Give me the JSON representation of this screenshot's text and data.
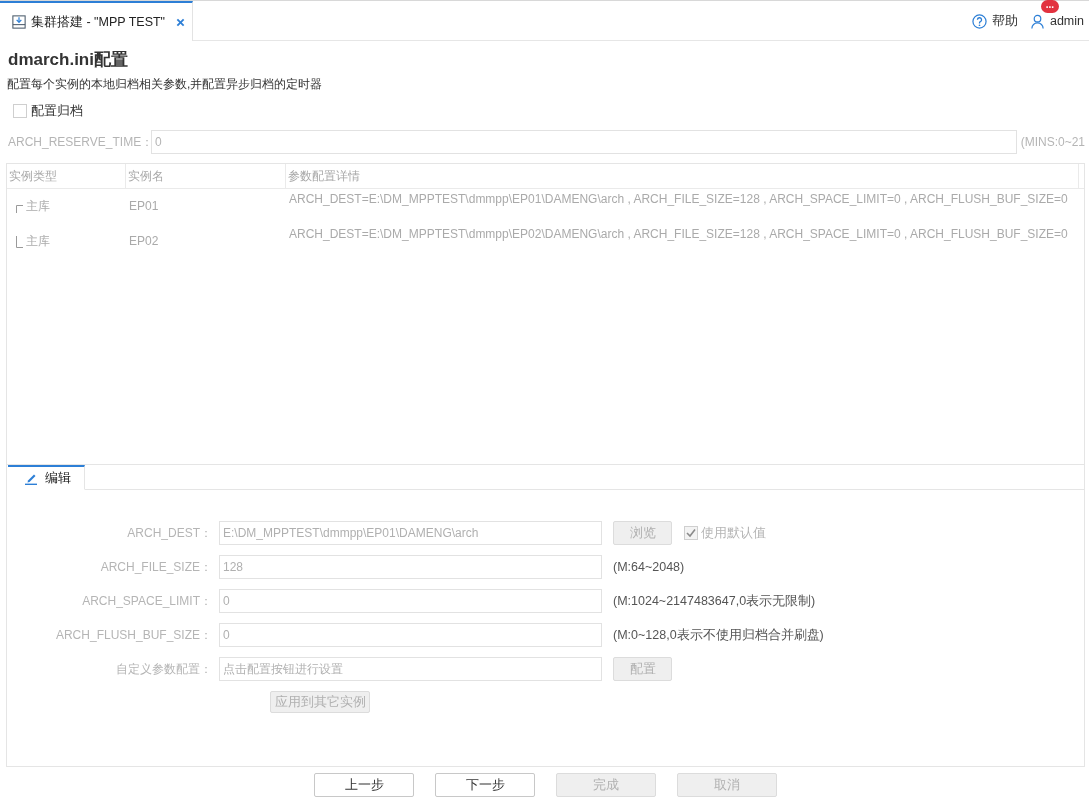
{
  "tabs": [
    {
      "label": "集群搭建 - \"MPP TEST\"",
      "selected": true,
      "closable": true
    }
  ],
  "header": {
    "help": "帮助",
    "user": "admin",
    "badge": "..."
  },
  "page": {
    "title": "dmarch.ini配置",
    "description": "配置每个实例的本地归档相关参数,并配置异步归档的定时器"
  },
  "archive_option": {
    "label": "配置归档",
    "checked": false
  },
  "reserve_time": {
    "label": "ARCH_RESERVE_TIME：",
    "value": "0",
    "hint": "(MINS:0~21",
    "disabled": true
  },
  "table": {
    "columns": [
      "实例类型",
      "实例名",
      "参数配置详情"
    ],
    "rows": [
      {
        "type": "主库",
        "name": "EP01",
        "details": "ARCH_DEST=E:\\DM_MPPTEST\\dmmpp\\EP01\\DAMENG\\arch , ARCH_FILE_SIZE=128 , ARCH_SPACE_LIMIT=0 , ARCH_FLUSH_BUF_SIZE=0"
      },
      {
        "type": "主库",
        "name": "EP02",
        "details": "ARCH_DEST=E:\\DM_MPPTEST\\dmmpp\\EP02\\DAMENG\\arch , ARCH_FILE_SIZE=128 , ARCH_SPACE_LIMIT=0 , ARCH_FLUSH_BUF_SIZE=0"
      }
    ]
  },
  "edit_tabs": [
    {
      "label": "编辑",
      "selected": true
    }
  ],
  "edit_form": {
    "disabled": true,
    "fields": [
      {
        "kind": "browse",
        "label": "ARCH_DEST：",
        "value": "E:\\DM_MPPTEST\\dmmpp\\EP01\\DAMENG\\arch",
        "button": "浏览",
        "checkbox": {
          "label": "使用默认值",
          "checked": true
        }
      },
      {
        "kind": "hint",
        "label": "ARCH_FILE_SIZE：",
        "value": "128",
        "hint": "(M:64~2048)"
      },
      {
        "kind": "hint",
        "label": "ARCH_SPACE_LIMIT：",
        "value": "0",
        "hint": "(M:1024~2147483647,0表示无限制)"
      },
      {
        "kind": "hint",
        "label": "ARCH_FLUSH_BUF_SIZE：",
        "value": "0",
        "hint": "(M:0~128,0表示不使用归档合并刷盘)"
      },
      {
        "kind": "config",
        "label": "自定义参数配置：",
        "placeholder": "点击配置按钮进行设置",
        "button": "配置"
      }
    ],
    "apply_button": {
      "label": "应用到其它实例",
      "disabled": true
    }
  },
  "footer_buttons": [
    {
      "label": "上一步",
      "disabled": false
    },
    {
      "label": "下一步",
      "disabled": false
    },
    {
      "label": "完成",
      "disabled": true
    },
    {
      "label": "取消",
      "disabled": true
    }
  ]
}
